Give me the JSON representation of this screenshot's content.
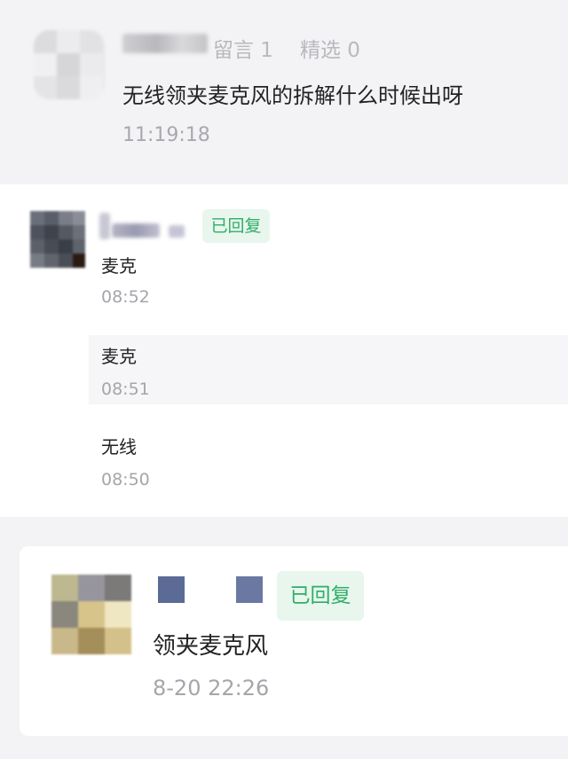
{
  "top_comment": {
    "likes_label": "留言 1",
    "featured_label": "精选 0",
    "text": "无线领夹麦克风的拆解什么时候出呀",
    "time": "11:19:18"
  },
  "middle_comment": {
    "replied_tag": "已回复",
    "replies": [
      {
        "text": "麦克",
        "time": "08:52"
      },
      {
        "text": "麦克",
        "time": "08:51"
      },
      {
        "text": "无线",
        "time": "08:50"
      }
    ]
  },
  "bottom_comment": {
    "replied_tag": "已回复",
    "text": "领夹麦克风",
    "time": "8-20 22:26"
  },
  "colors": {
    "background": "#f3f3f5",
    "tag_green": "#2fae66",
    "tag_bg": "#e8f6ee"
  }
}
